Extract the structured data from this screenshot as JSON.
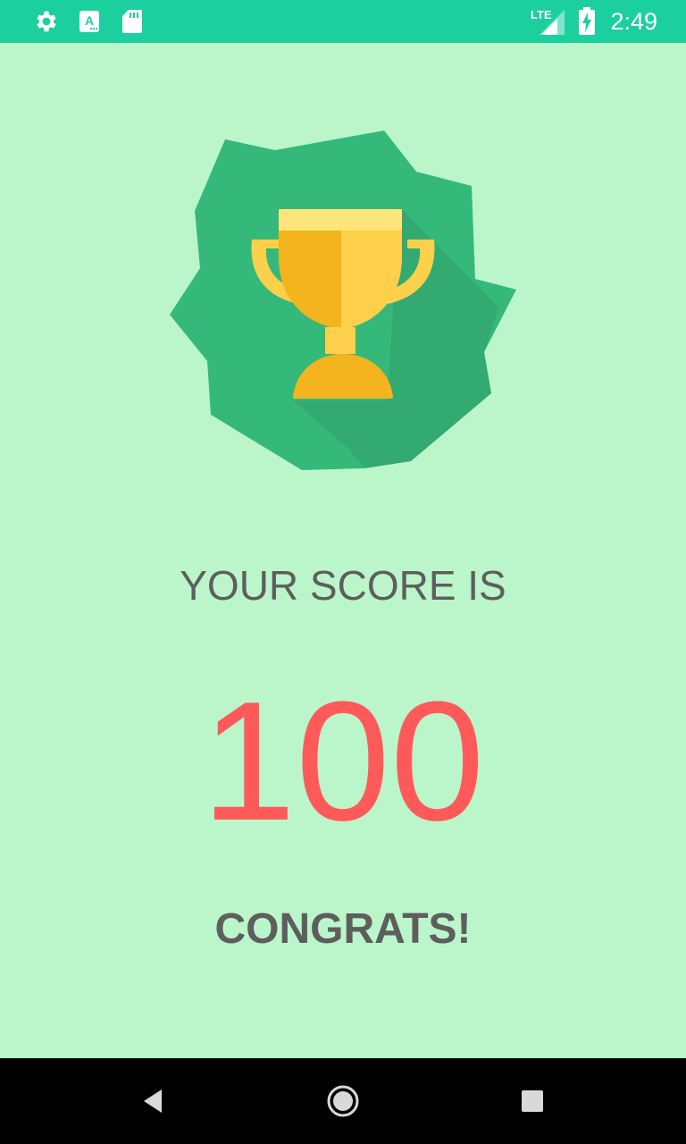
{
  "status_bar": {
    "time": "2:49",
    "network": "LTE",
    "left_icons": [
      "settings-icon",
      "keyboard-a-icon",
      "sd-card-icon"
    ],
    "right_icons": [
      "lte-signal-icon",
      "battery-charging-icon"
    ]
  },
  "result": {
    "score_label": "YOUR SCORE IS",
    "score_value": "100",
    "message": "CONGRATS!"
  },
  "badge": {
    "icon": "trophy-icon"
  },
  "nav_bar": {
    "buttons": [
      "back-icon",
      "home-icon",
      "recents-icon"
    ]
  },
  "colors": {
    "status_bar": "#1bcf9f",
    "background": "#bbf6cb",
    "badge_green": "#35b97a",
    "trophy_gold": "#fcd04a",
    "score_red": "#ff5a5a",
    "text_gray": "#5e5e5e"
  }
}
